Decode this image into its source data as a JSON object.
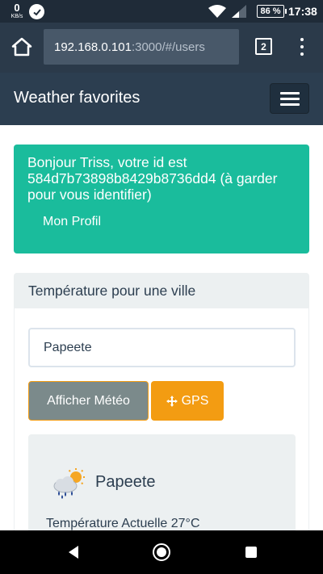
{
  "status_bar": {
    "speed_value": "0",
    "speed_unit": "KB/s",
    "battery": "86 %",
    "time": "17:38",
    "icons": [
      "check-icon",
      "wifi-icon",
      "signal-icon",
      "battery-icon"
    ]
  },
  "browser": {
    "url_host": "192.168.0.101",
    "url_path": ":3000/#/users",
    "tabs_count": "2",
    "icons": [
      "home-icon",
      "tabs-icon",
      "menu-dots-icon"
    ]
  },
  "navbar": {
    "brand": "Weather favorites"
  },
  "alert": {
    "message": "Bonjour Triss, votre id est 584d7b73898b8429b8736dd4 (à garder pour vous identifier)",
    "profile_link": "Mon Profil"
  },
  "panel": {
    "heading": "Température pour une ville",
    "city_input_value": "Papeete",
    "show_weather_button": "Afficher Météo",
    "gps_button": "GPS",
    "weather": {
      "city": "Papeete",
      "current_temperature": "Température Actuelle 27°C",
      "icon": "sun-cloud-rain-icon"
    }
  },
  "colors": {
    "navbar": "#2c3e50",
    "alert": "#1abc9c",
    "gps_button": "#f39c12",
    "show_weather_button": "#7b8a8b",
    "panel_bg": "#ecf0f1"
  }
}
